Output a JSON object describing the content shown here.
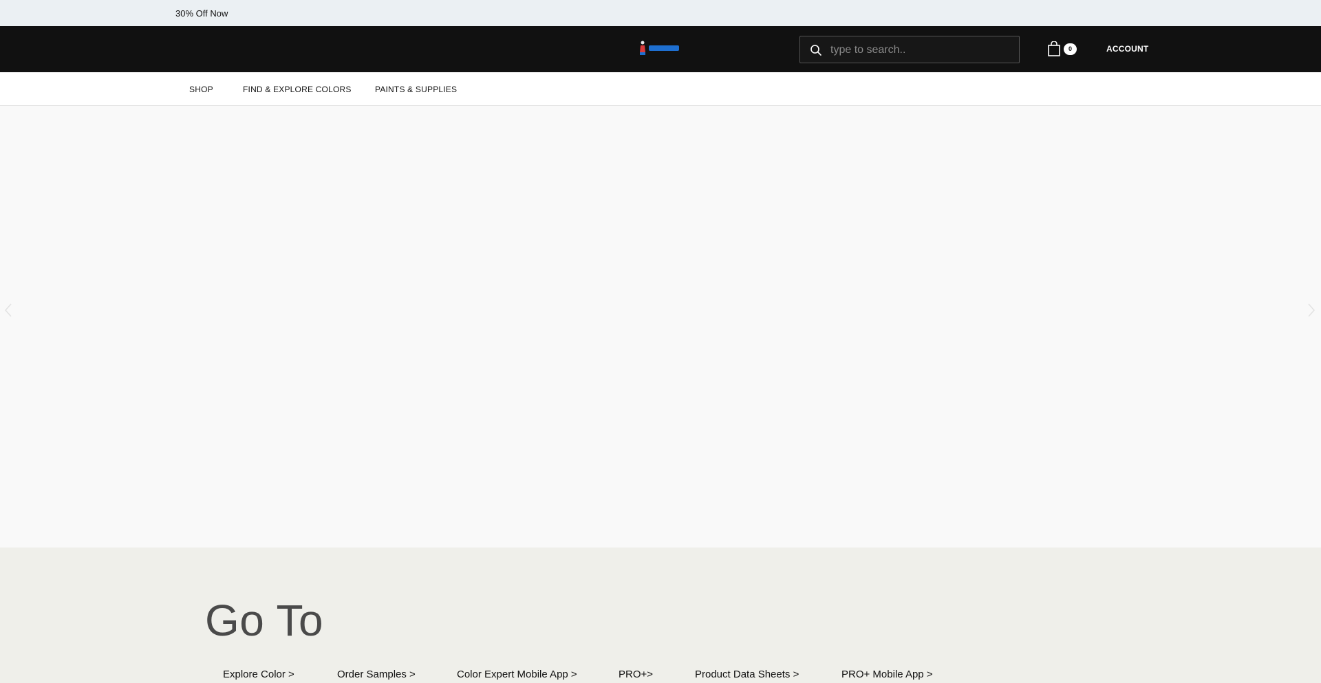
{
  "promo": {
    "text": "30% Off Now"
  },
  "header": {
    "search": {
      "placeholder": "type to search.."
    },
    "cart": {
      "count": "0"
    },
    "account_label": "ACCOUNT"
  },
  "nav": {
    "items": [
      {
        "label": "SHOP"
      },
      {
        "label": "FIND & EXPLORE COLORS"
      },
      {
        "label": "PAINTS & SUPPLIES"
      }
    ]
  },
  "icons": {
    "search": "search-icon",
    "cart": "shopping-bag-icon",
    "prev": "chevron-left-icon",
    "next": "chevron-right-icon"
  },
  "colors": {
    "promo_bg": "#ebf0f3",
    "header_bg": "#111111",
    "goto_bg": "#efefea",
    "logo_accent": "#1e6fd0"
  },
  "go_to": {
    "title": "Go To",
    "links": [
      {
        "label": "Explore Color >"
      },
      {
        "label": "Order Samples >"
      },
      {
        "label": "Color Expert Mobile App >"
      },
      {
        "label": "PRO+>"
      },
      {
        "label": "Product Data Sheets >"
      },
      {
        "label": "PRO+ Mobile App >"
      }
    ]
  }
}
